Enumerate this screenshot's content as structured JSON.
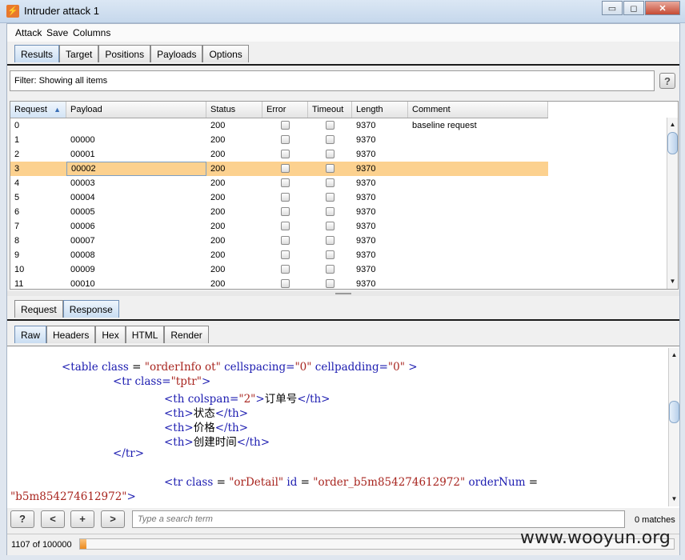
{
  "window": {
    "title": "Intruder attack 1",
    "minimize": "▭",
    "restore": "◻",
    "close": "✕"
  },
  "menu": [
    "Attack",
    "Save",
    "Columns"
  ],
  "top_tabs": [
    "Results",
    "Target",
    "Positions",
    "Payloads",
    "Options"
  ],
  "active_top_tab": "Results",
  "filter": {
    "label": "Filter:",
    "value": "Showing all items"
  },
  "help": "?",
  "table": {
    "columns": [
      "Request",
      "Payload",
      "Status",
      "Error",
      "Timeout",
      "Length",
      "Comment"
    ],
    "sort_column": "Request",
    "sort_direction": "ascending",
    "rows": [
      {
        "request": "0",
        "payload": "",
        "status": "200",
        "error": false,
        "timeout": false,
        "length": "9370",
        "comment": "baseline request"
      },
      {
        "request": "1",
        "payload": "00000",
        "status": "200",
        "error": false,
        "timeout": false,
        "length": "9370",
        "comment": ""
      },
      {
        "request": "2",
        "payload": "00001",
        "status": "200",
        "error": false,
        "timeout": false,
        "length": "9370",
        "comment": ""
      },
      {
        "request": "3",
        "payload": "00002",
        "status": "200",
        "error": false,
        "timeout": false,
        "length": "9370",
        "comment": ""
      },
      {
        "request": "4",
        "payload": "00003",
        "status": "200",
        "error": false,
        "timeout": false,
        "length": "9370",
        "comment": ""
      },
      {
        "request": "5",
        "payload": "00004",
        "status": "200",
        "error": false,
        "timeout": false,
        "length": "9370",
        "comment": ""
      },
      {
        "request": "6",
        "payload": "00005",
        "status": "200",
        "error": false,
        "timeout": false,
        "length": "9370",
        "comment": ""
      },
      {
        "request": "7",
        "payload": "00006",
        "status": "200",
        "error": false,
        "timeout": false,
        "length": "9370",
        "comment": ""
      },
      {
        "request": "8",
        "payload": "00007",
        "status": "200",
        "error": false,
        "timeout": false,
        "length": "9370",
        "comment": ""
      },
      {
        "request": "9",
        "payload": "00008",
        "status": "200",
        "error": false,
        "timeout": false,
        "length": "9370",
        "comment": ""
      },
      {
        "request": "10",
        "payload": "00009",
        "status": "200",
        "error": false,
        "timeout": false,
        "length": "9370",
        "comment": ""
      },
      {
        "request": "11",
        "payload": "00010",
        "status": "200",
        "error": false,
        "timeout": false,
        "length": "9370",
        "comment": ""
      }
    ],
    "selected_row": "3"
  },
  "msg_tabs": [
    "Request",
    "Response"
  ],
  "active_msg_tab": "Response",
  "view_tabs": [
    "Raw",
    "Headers",
    "Hex",
    "HTML",
    "Render"
  ],
  "active_view_tab": "Raw",
  "code_lines": [
    [
      [
        "tag",
        "<table "
      ],
      [
        "attr",
        "class"
      ],
      [
        "txt",
        " = "
      ],
      [
        "val",
        "\"orderInfo ot\""
      ],
      [
        "txt",
        " "
      ],
      [
        "attr",
        "cellspacing="
      ],
      [
        "val",
        "\"0\""
      ],
      [
        "txt",
        " "
      ],
      [
        "attr",
        "cellpadding="
      ],
      [
        "val",
        "\"0\""
      ],
      [
        "txt",
        " "
      ],
      [
        "tag",
        ">"
      ]
    ],
    [
      [
        "tag",
        "<tr "
      ],
      [
        "attr",
        "class="
      ],
      [
        "val",
        "\"tptr\""
      ],
      [
        "tag",
        ">"
      ]
    ],
    [
      [
        "tag",
        "<th "
      ],
      [
        "attr",
        "colspan="
      ],
      [
        "val",
        "\"2\""
      ],
      [
        "tag",
        ">"
      ],
      [
        "txt",
        "订单号"
      ],
      [
        "tag",
        "</th>"
      ]
    ],
    [
      [
        "tag",
        "<th>"
      ],
      [
        "txt",
        "状态"
      ],
      [
        "tag",
        "</th>"
      ]
    ],
    [
      [
        "tag",
        "<th>"
      ],
      [
        "txt",
        "价格"
      ],
      [
        "tag",
        "</th>"
      ]
    ],
    [
      [
        "tag",
        "<th>"
      ],
      [
        "txt",
        "创建时间"
      ],
      [
        "tag",
        "</th>"
      ]
    ],
    [
      [
        "tag",
        "</tr>"
      ]
    ],
    [],
    [
      [
        "tag",
        "<tr "
      ],
      [
        "attr",
        "class"
      ],
      [
        "txt",
        " = "
      ],
      [
        "val",
        "\"orDetail\""
      ],
      [
        "txt",
        " "
      ],
      [
        "attr",
        "id"
      ],
      [
        "txt",
        " = "
      ],
      [
        "val",
        "\"order_b5m854274612972\""
      ],
      [
        "txt",
        " "
      ],
      [
        "attr",
        "orderNum"
      ],
      [
        "txt",
        " ="
      ]
    ],
    [
      [
        "val",
        "\"b5m854274612972\""
      ],
      [
        "tag",
        ">"
      ]
    ]
  ],
  "nav": {
    "help": "?",
    "prev": "<",
    "add": "+",
    "next": ">"
  },
  "search": {
    "placeholder": "Type a search term",
    "value": ""
  },
  "matches": "0 matches",
  "status": {
    "count": "1107 of 100000",
    "progress": 0.011
  },
  "watermark": "www.wooyun.org"
}
